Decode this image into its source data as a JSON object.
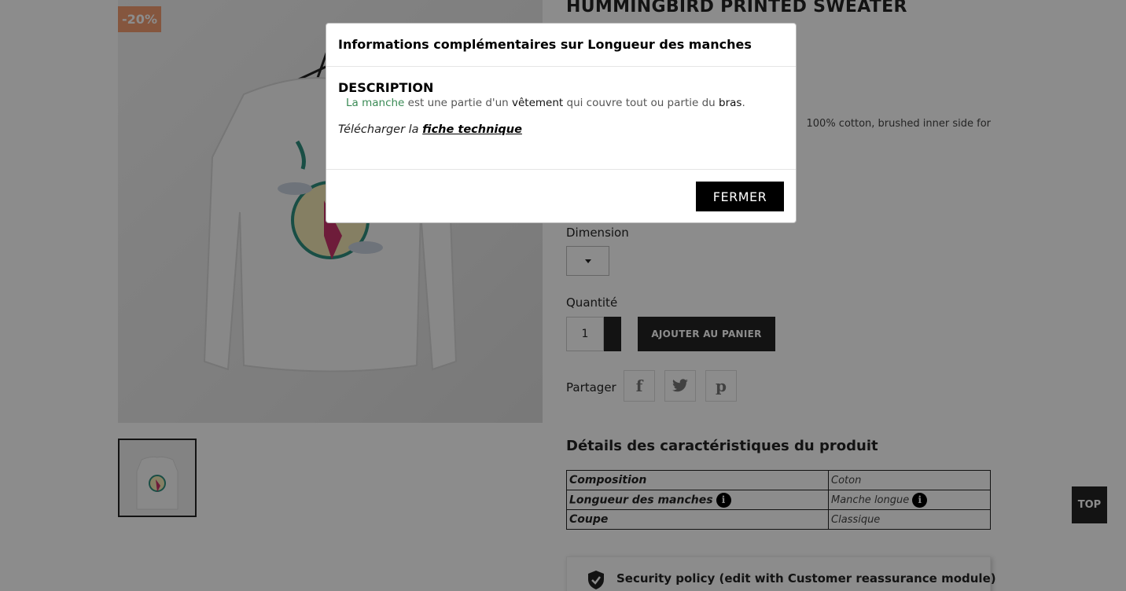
{
  "product": {
    "badge": "-20%",
    "title": "HUMMINGBIRD PRINTED SWEATER",
    "description_visible": "100% cotton, brushed inner side for",
    "dimension_label": "Dimension",
    "quantity_label": "Quantité",
    "quantity_value": "1",
    "add_to_cart": "AJOUTER AU PANIER",
    "share_label": "Partager",
    "share_icons": [
      "facebook-icon",
      "twitter-icon",
      "pinterest-icon"
    ]
  },
  "features": {
    "title": "Détails des caractéristiques du produit",
    "rows": [
      {
        "key": "Composition",
        "value": "Coton",
        "key_info": false,
        "value_info": false
      },
      {
        "key": "Longueur des manches",
        "value": "Manche longue",
        "key_info": true,
        "value_info": true
      },
      {
        "key": "Coupe",
        "value": "Classique",
        "key_info": false,
        "value_info": false
      }
    ],
    "info_glyph": "i"
  },
  "reassurance": {
    "text": "Security policy (edit with Customer reassurance module)"
  },
  "top_button": "TOP",
  "modal": {
    "title": "Informations complémentaires sur Longueur des manches",
    "heading": "DESCRIPTION",
    "text_parts": [
      "La manche",
      " est une partie d'un ",
      "vêtement",
      " qui couvre tout ou partie du ",
      "bras",
      "."
    ],
    "download_prefix": "Télécharger la ",
    "download_link": "fiche technique",
    "close": "FERMER"
  },
  "colors": {
    "dark": "#232323",
    "badge": "#f39d72",
    "link_green": "#3a8a55"
  }
}
